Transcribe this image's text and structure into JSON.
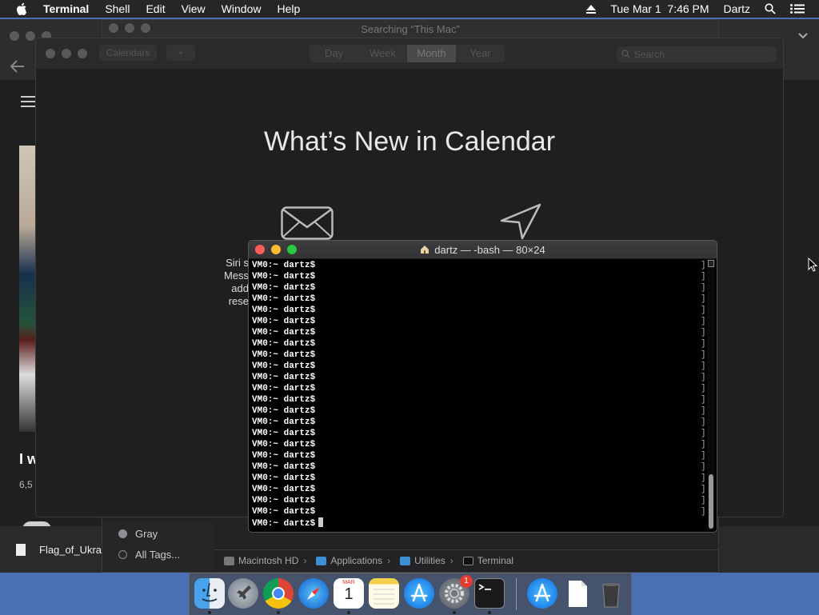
{
  "menubar": {
    "app_name": "Terminal",
    "menus": [
      "Shell",
      "Edit",
      "View",
      "Window",
      "Help"
    ],
    "datetime": "Tue Mar 1  7:46 PM",
    "user": "Dartz",
    "icons": [
      "apple-icon",
      "eject-icon",
      "spotlight-icon",
      "notification-center-icon"
    ]
  },
  "browser": {
    "partial_title": "I w",
    "partial_count": "6,5",
    "download_filename": "Flag_of_Ukra"
  },
  "finder": {
    "title": "Searching “This Mac”",
    "tags": [
      {
        "label": "Gray",
        "color": "#8e8e93"
      },
      {
        "label": "All Tags...",
        "color": "#3a3a3c"
      }
    ],
    "path": [
      "Macintosh HD",
      "Applications",
      "Utilities",
      "Terminal"
    ]
  },
  "calendar": {
    "toolbar_calendars": "Calendars",
    "toolbar_add": "+",
    "views": [
      "Day",
      "Week",
      "Month",
      "Year"
    ],
    "active_view": "Month",
    "search_placeholder": "Search",
    "heading": "What’s New in Calendar",
    "siri_text": [
      "Siri s",
      "Mess",
      "add",
      "rese"
    ]
  },
  "terminal": {
    "title": "dartz — -bash — 80×24",
    "prompt": "VM0:~ dartz$",
    "line_count": 24
  },
  "dock": {
    "apps": [
      "Finder",
      "Launchpad",
      "Google Chrome",
      "Safari",
      "Calendar",
      "Notes",
      "App Store",
      "System Preferences",
      "Terminal",
      "Downloads",
      "Document",
      "Trash"
    ],
    "calendar_month": "MAR",
    "calendar_day": "1",
    "sysprefs_badge": "1"
  },
  "colors": {
    "close": "#ff5f57",
    "minimize": "#febc2e",
    "zoom": "#28c840"
  }
}
